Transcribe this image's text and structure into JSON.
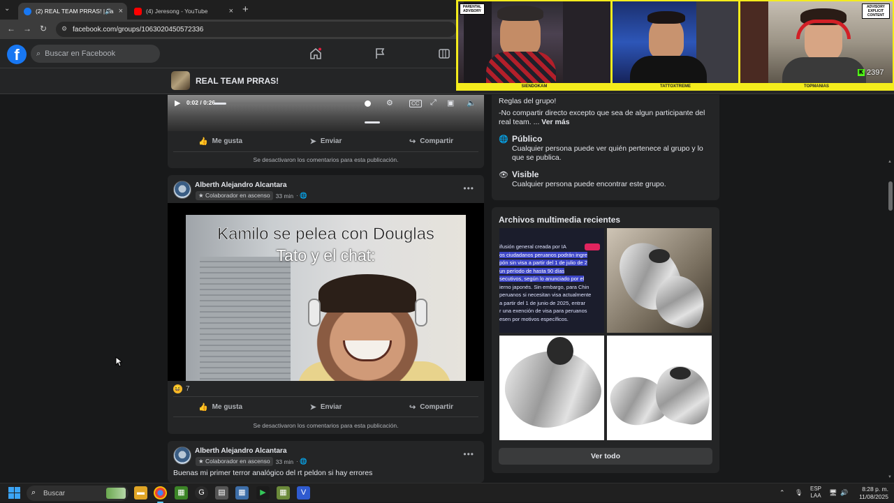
{
  "browser": {
    "tabs": [
      {
        "title": "(2) REAL TEAM PRRAS! | Fa",
        "active": true,
        "favicon": "facebook-icon"
      },
      {
        "title": "(4) Jeresong - YouTube",
        "active": false,
        "favicon": "youtube-icon"
      }
    ],
    "url": "facebook.com/groups/1063020450572336"
  },
  "facebook": {
    "search_placeholder": "Buscar en Facebook",
    "brand_color": "#1877f2",
    "group_name": "REAL TEAM PRRAS!"
  },
  "posts": [
    {
      "video": {
        "time": "0:02 / 0:26",
        "progress": 0.08
      },
      "actions": {
        "like": "Me gusta",
        "send": "Enviar",
        "share": "Compartir"
      },
      "comments_off": "Se desactivaron los comentarios para esta publicación."
    },
    {
      "author": "Alberth Alejandro Alcantara",
      "badge": "Colaborador en ascenso",
      "time": "33 min",
      "meme_title": "Kamilo se pelea con Douglas",
      "meme_subtitle": "Tato y el chat:",
      "reaction_count": "7",
      "actions": {
        "like": "Me gusta",
        "send": "Enviar",
        "share": "Compartir"
      },
      "comments_off": "Se desactivaron los comentarios para esta publicación."
    },
    {
      "author": "Alberth Alejandro Alcantara",
      "badge": "Colaborador en ascenso",
      "time": "33 min",
      "text": "Buenas mi primer terror analógico del rt peldon si hay errores"
    }
  ],
  "sidebar": {
    "rules_title": "Reglas del grupo!",
    "rules_text": "-No compartir directo excepto que sea de algun participante del real team. ...",
    "see_more": "Ver más",
    "public_title": "Público",
    "public_desc": "Cualquier persona puede ver quién pertenece al grupo y lo que se publica.",
    "visible_title": "Visible",
    "visible_desc": "Cualquier persona puede encontrar este grupo.",
    "media_title": "Archivos multimedia recientes",
    "news_lines": [
      "ifusión general creada por IA",
      "os ciudadanos peruanos podrán ingre",
      "pón sin visa a partir del 1 de julio de 2",
      "un período de hasta 90 días",
      "secutivos, según lo anunciado por el",
      "ierno japonés. Sin embargo, para Chin",
      "peruanos si necesitan visa actualmente",
      "a partir del 1 de junio de 2025, entrar",
      "r una exención de visa para peruanos",
      "esen por motivos específicos."
    ],
    "see_all": "Ver todo"
  },
  "stream_overlay": {
    "cams": [
      "SIENDOKAM",
      "TATTOXTREME",
      "TOPMANIAS"
    ],
    "advisory_top": "PARENTAL",
    "advisory_mid": "ADVISORY",
    "advisory_bottom": "EXPLICIT CONTENT",
    "viewer_count": "2397",
    "accent": "#f4ec1c"
  },
  "taskbar": {
    "search_placeholder": "Buscar",
    "lang_top": "ESP",
    "lang_bottom": "LAA",
    "time": "8:28 p. m.",
    "date": "11/08/2025"
  }
}
